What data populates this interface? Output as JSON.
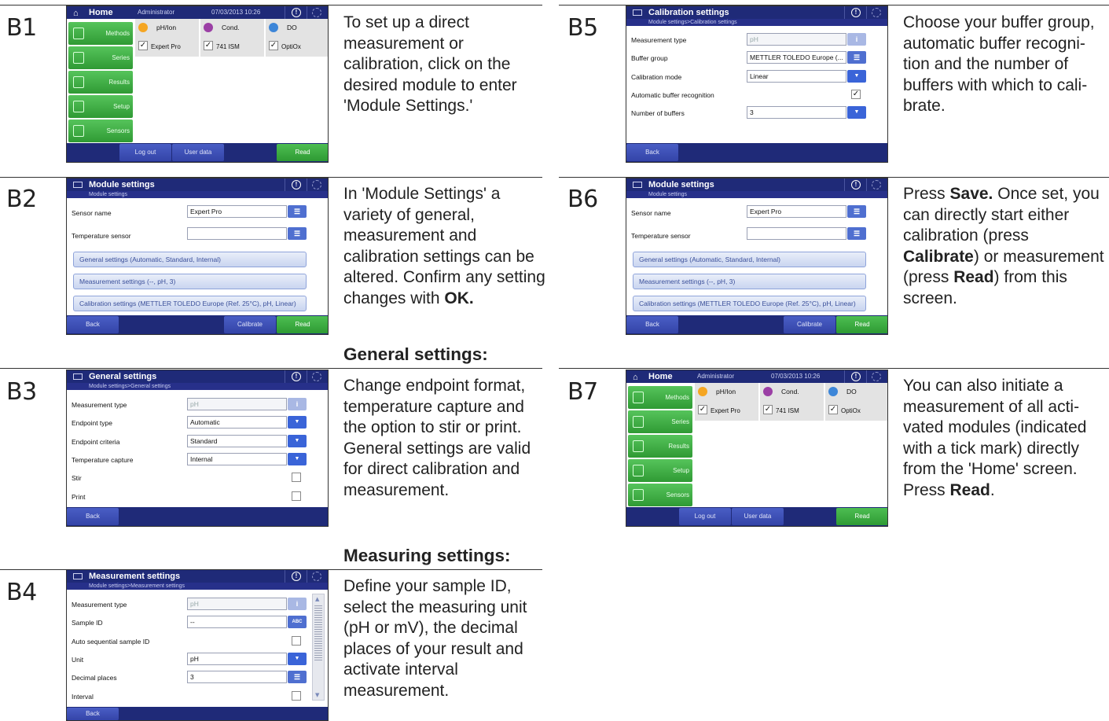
{
  "steps": [
    {
      "id": "B1",
      "text_parts": [
        {
          "t": "To set up a direct measurement or calibration, click on the desired module to enter 'Module Settings.'",
          "b": false
        }
      ]
    },
    {
      "id": "B2",
      "text_parts": [
        {
          "t": "In 'Module Settings' a variety of general, measurement and calibration settings can be altered. Confirm any setting changes with ",
          "b": false
        },
        {
          "t": "OK.",
          "b": true
        }
      ]
    },
    {
      "id": "B3",
      "text_parts": [
        {
          "t": "Change endpoint format, temperature capture and the option to stir or print. General settings are valid for direct calibration and measurement.",
          "b": false
        }
      ]
    },
    {
      "id": "B4",
      "text_parts": [
        {
          "t": "Define your sample ID, select the measuring unit (pH or mV), the decimal places of your result and activate interval measurement.",
          "b": false
        }
      ]
    },
    {
      "id": "B5",
      "text_parts": [
        {
          "t": "Choose your buffer group, automatic buffer recogni-tion and the number of buffers with which to cali-brate.",
          "b": false
        }
      ]
    },
    {
      "id": "B6",
      "text_parts": [
        {
          "t": "Press ",
          "b": false
        },
        {
          "t": "Save.",
          "b": true
        },
        {
          "t": " Once set, you can directly start either calibration (press ",
          "b": false
        },
        {
          "t": "Calibrate",
          "b": true
        },
        {
          "t": ") or measurement (press ",
          "b": false
        },
        {
          "t": "Read",
          "b": true
        },
        {
          "t": ") from this screen.",
          "b": false
        }
      ]
    },
    {
      "id": "B7",
      "text_parts": [
        {
          "t": "You can also initiate a measurement of all acti-vated modules (indicated with a tick mark) directly from the 'Home' screen. Press ",
          "b": false
        },
        {
          "t": "Read",
          "b": true
        },
        {
          "t": ".",
          "b": false
        }
      ]
    }
  ],
  "section_headings": {
    "general": "General settings:",
    "measuring": "Measuring settings:"
  },
  "home": {
    "title": "Home",
    "user": "Administrator",
    "datetime": "07/03/2013 10:26",
    "sidebar": [
      "Methods",
      "Series",
      "Results",
      "Setup",
      "Sensors"
    ],
    "modules": [
      {
        "name": "pH/Ion",
        "sensor": "Expert Pro",
        "color": "#f5a623"
      },
      {
        "name": "Cond.",
        "sensor": "741 ISM",
        "color": "#9b3fa5"
      },
      {
        "name": "DO",
        "sensor": "OptiOx",
        "color": "#3d86d8"
      }
    ],
    "footer": {
      "logout": "Log out",
      "userdata": "User data",
      "read": "Read"
    }
  },
  "module_settings": {
    "title": "Module settings",
    "crumb": "Module settings",
    "sensor_name_label": "Sensor name",
    "sensor_name_value": "Expert Pro",
    "temp_sensor_label": "Temperature sensor",
    "temp_sensor_value": "",
    "bar_general": "General settings (Automatic, Standard, Internal)",
    "bar_measurement": "Measurement settings (--, pH, 3)",
    "bar_calibration": "Calibration settings (METTLER TOLEDO Europe (Ref. 25°C), pH, Linear)",
    "footer": {
      "back": "Back",
      "calibrate": "Calibrate",
      "read": "Read"
    }
  },
  "general_settings": {
    "title": "General settings",
    "crumb": "Module settings>General settings",
    "rows": [
      {
        "label": "Measurement type",
        "value": "pH",
        "kind": "info"
      },
      {
        "label": "Endpoint type",
        "value": "Automatic",
        "kind": "dd"
      },
      {
        "label": "Endpoint criteria",
        "value": "Standard",
        "kind": "dd"
      },
      {
        "label": "Temperature capture",
        "value": "Internal",
        "kind": "dd"
      },
      {
        "label": "Stir",
        "value": "",
        "kind": "check"
      },
      {
        "label": "Print",
        "value": "",
        "kind": "check"
      }
    ],
    "footer": {
      "back": "Back"
    }
  },
  "measurement_settings": {
    "title": "Measurement settings",
    "crumb": "Module settings>Measurement settings",
    "rows": [
      {
        "label": "Measurement type",
        "value": "pH",
        "kind": "info"
      },
      {
        "label": "Sample ID",
        "value": "--",
        "kind": "abc"
      },
      {
        "label": "Auto sequential sample ID",
        "value": "",
        "kind": "check"
      },
      {
        "label": "Unit",
        "value": "pH",
        "kind": "dd"
      },
      {
        "label": "Decimal places",
        "value": "3",
        "kind": "list"
      },
      {
        "label": "Interval",
        "value": "",
        "kind": "check"
      }
    ],
    "abc_label": "ABC",
    "footer": {
      "back": "Back"
    }
  },
  "calibration_settings": {
    "title": "Calibration settings",
    "crumb": "Module settings>Calibration settings",
    "rows": [
      {
        "label": "Measurement type",
        "value": "pH",
        "kind": "info"
      },
      {
        "label": "Buffer group",
        "value": "METTLER TOLEDO Europe (...",
        "kind": "list"
      },
      {
        "label": "Calibration mode",
        "value": "Linear",
        "kind": "dd"
      },
      {
        "label": "Automatic buffer recognition",
        "value": "",
        "kind": "checked"
      },
      {
        "label": "Number of buffers",
        "value": "3",
        "kind": "dd"
      }
    ],
    "footer": {
      "back": "Back"
    }
  }
}
